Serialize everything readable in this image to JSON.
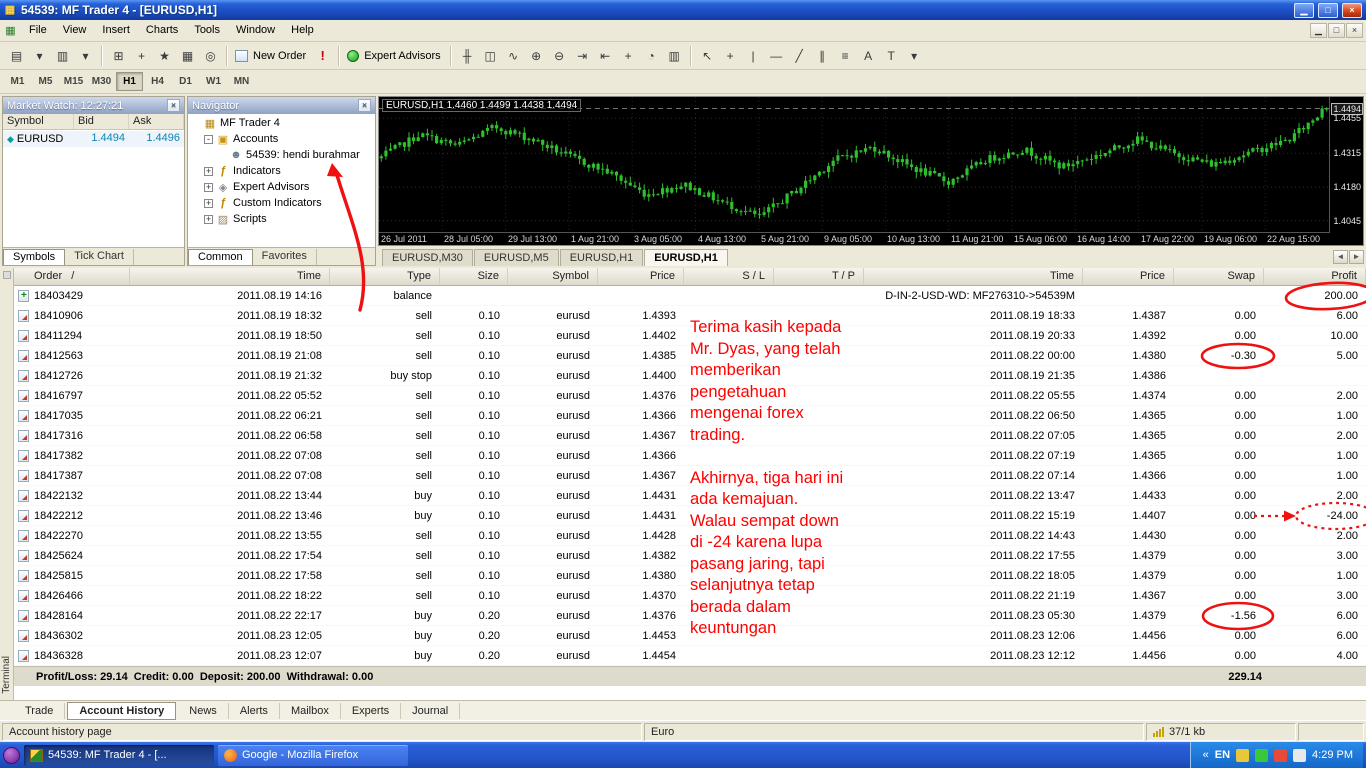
{
  "window": {
    "title": "54539: MF Trader 4 - [EURUSD,H1]"
  },
  "menu": {
    "items": [
      "File",
      "View",
      "Insert",
      "Charts",
      "Tools",
      "Window",
      "Help"
    ]
  },
  "toolbar": {
    "icons_file": [
      {
        "name": "new-chart-icon",
        "glyph": "▤"
      },
      {
        "name": "new-chart-dropdown-icon",
        "glyph": "▾"
      },
      {
        "name": "profiles-icon",
        "glyph": "▥"
      },
      {
        "name": "profiles-dropdown-icon",
        "glyph": "▾"
      }
    ],
    "icons_view": [
      {
        "name": "market-watch-icon",
        "glyph": "⊞"
      },
      {
        "name": "data-window-icon",
        "glyph": "+"
      },
      {
        "name": "navigator-icon",
        "glyph": "★"
      },
      {
        "name": "terminal-icon",
        "glyph": "▦"
      },
      {
        "name": "strategy-tester-icon",
        "glyph": "◎"
      }
    ],
    "new_order_label": "New Order",
    "alert_glyph": "!",
    "ea_label": "Expert Advisors",
    "icons_chart": [
      {
        "name": "bar-chart-icon",
        "glyph": "╫"
      },
      {
        "name": "candlestick-icon",
        "glyph": "◫"
      },
      {
        "name": "line-chart-icon",
        "glyph": "∿"
      },
      {
        "name": "zoom-in-icon",
        "glyph": "⊕"
      },
      {
        "name": "zoom-out-icon",
        "glyph": "⊖"
      },
      {
        "name": "auto-scroll-icon",
        "glyph": "⇥"
      },
      {
        "name": "chart-shift-icon",
        "glyph": "⇤"
      },
      {
        "name": "add-indicator-icon",
        "glyph": "+"
      },
      {
        "name": "periods-icon",
        "glyph": "◔"
      },
      {
        "name": "templates-icon",
        "glyph": "▥"
      }
    ],
    "icons_line": [
      {
        "name": "cursor-icon",
        "glyph": "↖"
      },
      {
        "name": "crosshair-icon",
        "glyph": "+"
      },
      {
        "name": "vertical-line-icon",
        "glyph": "|"
      },
      {
        "name": "horizontal-line-icon",
        "glyph": "—"
      },
      {
        "name": "trendline-icon",
        "glyph": "╱"
      },
      {
        "name": "channel-icon",
        "glyph": "∥"
      },
      {
        "name": "fibonacci-icon",
        "glyph": "≡"
      },
      {
        "name": "text-icon",
        "glyph": "A"
      },
      {
        "name": "text-label-icon",
        "glyph": "T"
      },
      {
        "name": "arrow-tools-icon",
        "glyph": "▾"
      }
    ]
  },
  "timeframe_bar": {
    "buttons": [
      "M1",
      "M5",
      "M15",
      "M30",
      "H1",
      "H4",
      "D1",
      "W1",
      "MN"
    ],
    "active": "H1"
  },
  "market_watch": {
    "title": "Market Watch: 12:27:21",
    "columns": [
      "Symbol",
      "Bid",
      "Ask"
    ],
    "rows": [
      {
        "symbol": "EURUSD",
        "bid": "1.4494",
        "ask": "1.4496"
      }
    ],
    "tabs": [
      "Symbols",
      "Tick Chart"
    ],
    "active_tab": "Symbols"
  },
  "navigator": {
    "title": "Navigator",
    "items": [
      {
        "label": "MF Trader 4",
        "depth": 0,
        "icon": "platform",
        "expander": ""
      },
      {
        "label": "Accounts",
        "depth": 1,
        "icon": "accounts",
        "expander": "-"
      },
      {
        "label": "54539: hendi burahmar",
        "depth": 2,
        "icon": "account",
        "expander": ""
      },
      {
        "label": "Indicators",
        "depth": 1,
        "icon": "indicators",
        "expander": "+"
      },
      {
        "label": "Expert Advisors",
        "depth": 1,
        "icon": "experts",
        "expander": "+"
      },
      {
        "label": "Custom Indicators",
        "depth": 1,
        "icon": "custom",
        "expander": "+"
      },
      {
        "label": "Scripts",
        "depth": 1,
        "icon": "scripts",
        "expander": "+"
      }
    ],
    "tabs": [
      "Common",
      "Favorites"
    ],
    "active_tab": "Common"
  },
  "chart": {
    "quote_line": "EURUSD,H1 1.4460 1.4499 1.4438 1.4494",
    "current_price": "1.4494",
    "time_ticks": [
      "26 Jul 2011",
      "28 Jul 05:00",
      "29 Jul 13:00",
      "1 Aug 21:00",
      "3 Aug 05:00",
      "4 Aug 13:00",
      "5 Aug 21:00",
      "9 Aug 05:00",
      "10 Aug 13:00",
      "11 Aug 21:00",
      "15 Aug 06:00",
      "16 Aug 14:00",
      "17 Aug 22:00",
      "19 Aug 06:00",
      "22 Aug 15:00"
    ],
    "candle_color": "#2fbf2f"
  },
  "chart_data": {
    "type": "candlestick",
    "symbol": "EURUSD",
    "timeframe": "H1",
    "open": 1.446,
    "high": 1.4499,
    "low": 1.4438,
    "close": 1.4494,
    "y_ticks": [
      1.4494,
      1.4455,
      1.4315,
      1.418,
      1.4045
    ],
    "trend_anchors": [
      1.43,
      1.439,
      1.4345,
      1.442,
      1.437,
      1.43,
      1.424,
      1.415,
      1.419,
      1.412,
      1.406,
      1.417,
      1.429,
      1.434,
      1.426,
      1.42,
      1.429,
      1.433,
      1.426,
      1.431,
      1.437,
      1.431,
      1.427,
      1.432,
      1.437,
      1.4494
    ]
  },
  "chart_tabs": {
    "tabs": [
      "EURUSD,M30",
      "EURUSD,M5",
      "EURUSD,H1",
      "EURUSD,H1"
    ],
    "active_index": 3
  },
  "history": {
    "columns": [
      "Order   /",
      "Time",
      "Type",
      "Size",
      "Symbol",
      "Price",
      "S / L",
      "T / P",
      "Time",
      "Price",
      "Swap",
      "Profit"
    ],
    "rows": [
      {
        "order": "18403429",
        "time": "2011.08.19 14:16",
        "type": "balance",
        "size": "",
        "symbol": "",
        "price": "",
        "sl": "",
        "tp": "",
        "time2": "D-IN-2-USD-WD: MF276310->54539M",
        "price2": "",
        "swap": "",
        "profit": "200.00",
        "kind": "balance"
      },
      {
        "order": "18410906",
        "time": "2011.08.19 18:32",
        "type": "sell",
        "size": "0.10",
        "symbol": "eurusd",
        "price": "1.4393",
        "sl": "",
        "tp": "",
        "time2": "2011.08.19 18:33",
        "price2": "1.4387",
        "swap": "0.00",
        "profit": "6.00",
        "kind": "trade"
      },
      {
        "order": "18411294",
        "time": "2011.08.19 18:50",
        "type": "sell",
        "size": "0.10",
        "symbol": "eurusd",
        "price": "1.4402",
        "sl": "",
        "tp": "",
        "time2": "2011.08.19 20:33",
        "price2": "1.4392",
        "swap": "0.00",
        "profit": "10.00",
        "kind": "trade"
      },
      {
        "order": "18412563",
        "time": "2011.08.19 21:08",
        "type": "sell",
        "size": "0.10",
        "symbol": "eurusd",
        "price": "1.4385",
        "sl": "",
        "tp": "",
        "time2": "2011.08.22 00:00",
        "price2": "1.4380",
        "swap": "-0.30",
        "profit": "5.00",
        "kind": "trade"
      },
      {
        "order": "18412726",
        "time": "2011.08.19 21:32",
        "type": "buy stop",
        "size": "0.10",
        "symbol": "eurusd",
        "price": "1.4400",
        "sl": "",
        "tp": "",
        "time2": "2011.08.19 21:35",
        "price2": "1.4386",
        "swap": "",
        "profit": "",
        "kind": "trade"
      },
      {
        "order": "18416797",
        "time": "2011.08.22 05:52",
        "type": "sell",
        "size": "0.10",
        "symbol": "eurusd",
        "price": "1.4376",
        "sl": "",
        "tp": "",
        "time2": "2011.08.22 05:55",
        "price2": "1.4374",
        "swap": "0.00",
        "profit": "2.00",
        "kind": "trade"
      },
      {
        "order": "18417035",
        "time": "2011.08.22 06:21",
        "type": "sell",
        "size": "0.10",
        "symbol": "eurusd",
        "price": "1.4366",
        "sl": "",
        "tp": "",
        "time2": "2011.08.22 06:50",
        "price2": "1.4365",
        "swap": "0.00",
        "profit": "1.00",
        "kind": "trade"
      },
      {
        "order": "18417316",
        "time": "2011.08.22 06:58",
        "type": "sell",
        "size": "0.10",
        "symbol": "eurusd",
        "price": "1.4367",
        "sl": "",
        "tp": "",
        "time2": "2011.08.22 07:05",
        "price2": "1.4365",
        "swap": "0.00",
        "profit": "2.00",
        "kind": "trade"
      },
      {
        "order": "18417382",
        "time": "2011.08.22 07:08",
        "type": "sell",
        "size": "0.10",
        "symbol": "eurusd",
        "price": "1.4366",
        "sl": "",
        "tp": "",
        "time2": "2011.08.22 07:19",
        "price2": "1.4365",
        "swap": "0.00",
        "profit": "1.00",
        "kind": "trade"
      },
      {
        "order": "18417387",
        "time": "2011.08.22 07:08",
        "type": "sell",
        "size": "0.10",
        "symbol": "eurusd",
        "price": "1.4367",
        "sl": "",
        "tp": "",
        "time2": "2011.08.22 07:14",
        "price2": "1.4366",
        "swap": "0.00",
        "profit": "1.00",
        "kind": "trade"
      },
      {
        "order": "18422132",
        "time": "2011.08.22 13:44",
        "type": "buy",
        "size": "0.10",
        "symbol": "eurusd",
        "price": "1.4431",
        "sl": "",
        "tp": "",
        "time2": "2011.08.22 13:47",
        "price2": "1.4433",
        "swap": "0.00",
        "profit": "2.00",
        "kind": "trade"
      },
      {
        "order": "18422212",
        "time": "2011.08.22 13:46",
        "type": "buy",
        "size": "0.10",
        "symbol": "eurusd",
        "price": "1.4431",
        "sl": "",
        "tp": "",
        "time2": "2011.08.22 15:19",
        "price2": "1.4407",
        "swap": "0.00",
        "profit": "-24.00",
        "kind": "trade"
      },
      {
        "order": "18422270",
        "time": "2011.08.22 13:55",
        "type": "sell",
        "size": "0.10",
        "symbol": "eurusd",
        "price": "1.4428",
        "sl": "",
        "tp": "",
        "time2": "2011.08.22 14:43",
        "price2": "1.4430",
        "swap": "0.00",
        "profit": "2.00",
        "kind": "trade"
      },
      {
        "order": "18425624",
        "time": "2011.08.22 17:54",
        "type": "sell",
        "size": "0.10",
        "symbol": "eurusd",
        "price": "1.4382",
        "sl": "",
        "tp": "",
        "time2": "2011.08.22 17:55",
        "price2": "1.4379",
        "swap": "0.00",
        "profit": "3.00",
        "kind": "trade"
      },
      {
        "order": "18425815",
        "time": "2011.08.22 17:58",
        "type": "sell",
        "size": "0.10",
        "symbol": "eurusd",
        "price": "1.4380",
        "sl": "",
        "tp": "",
        "time2": "2011.08.22 18:05",
        "price2": "1.4379",
        "swap": "0.00",
        "profit": "1.00",
        "kind": "trade"
      },
      {
        "order": "18426466",
        "time": "2011.08.22 18:22",
        "type": "sell",
        "size": "0.10",
        "symbol": "eurusd",
        "price": "1.4370",
        "sl": "",
        "tp": "",
        "time2": "2011.08.22 21:19",
        "price2": "1.4367",
        "swap": "0.00",
        "profit": "3.00",
        "kind": "trade"
      },
      {
        "order": "18428164",
        "time": "2011.08.22 22:17",
        "type": "buy",
        "size": "0.20",
        "symbol": "eurusd",
        "price": "1.4376",
        "sl": "",
        "tp": "",
        "time2": "2011.08.23 05:30",
        "price2": "1.4379",
        "swap": "-1.56",
        "profit": "6.00",
        "kind": "trade"
      },
      {
        "order": "18436302",
        "time": "2011.08.23 12:05",
        "type": "buy",
        "size": "0.20",
        "symbol": "eurusd",
        "price": "1.4453",
        "sl": "",
        "tp": "",
        "time2": "2011.08.23 12:06",
        "price2": "1.4456",
        "swap": "0.00",
        "profit": "6.00",
        "kind": "trade"
      },
      {
        "order": "18436328",
        "time": "2011.08.23 12:07",
        "type": "buy",
        "size": "0.20",
        "symbol": "eurusd",
        "price": "1.4454",
        "sl": "",
        "tp": "",
        "time2": "2011.08.23 12:12",
        "price2": "1.4456",
        "swap": "0.00",
        "profit": "4.00",
        "kind": "trade"
      }
    ],
    "summary": {
      "text": "Profit/Loss: 29.14  Credit: 0.00  Deposit: 200.00  Withdrawal: 0.00",
      "total": "229.14"
    },
    "tabs": [
      "Trade",
      "Account History",
      "News",
      "Alerts",
      "Mailbox",
      "Experts",
      "Journal"
    ],
    "active_tab": "Account History"
  },
  "terminal_label": "Terminal",
  "status_bar": {
    "left": "Account history page",
    "center": "Euro",
    "right": "37/1 kb"
  },
  "taskbar": {
    "buttons": [
      {
        "label": "54539: MF Trader 4 - [...",
        "active": true
      },
      {
        "label": "Google - Mozilla Firefox",
        "active": false
      }
    ],
    "tray": {
      "chevron_icon": "«",
      "language": "EN",
      "clock": "4:29 PM"
    }
  },
  "annotations": {
    "note": "Terima kasih kepada\nMr. Dyas, yang telah\nmemberikan\npengetahuan\nmengenai forex\ntrading.\n\nAkhirnya, tiga hari ini\nada kemajuan.\nWalau sempat down\ndi -24 karena lupa\npasang jaring, tapi\nselanjutnya tetap\nberada dalam\nkeuntungan",
    "color": "#ff0000"
  }
}
